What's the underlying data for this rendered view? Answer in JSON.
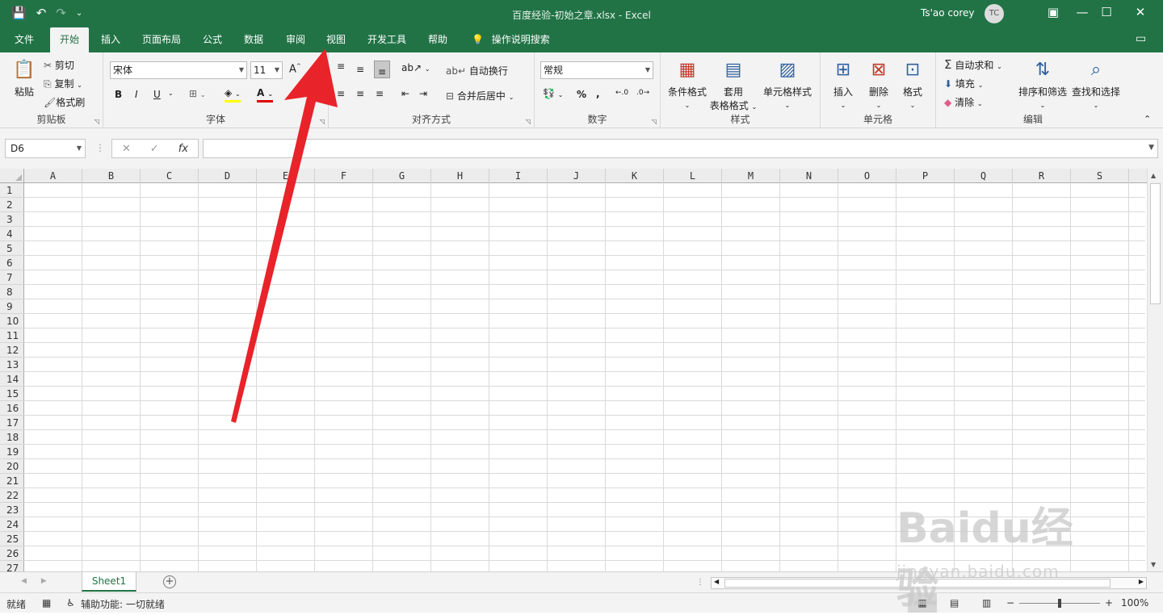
{
  "window": {
    "title": "百度经验-初始之章.xlsx  -  Excel",
    "user_name": "Ts'ao corey",
    "user_initials": "TC"
  },
  "tabs": [
    "文件",
    "开始",
    "插入",
    "页面布局",
    "公式",
    "数据",
    "审阅",
    "视图",
    "开发工具",
    "帮助"
  ],
  "active_tab": "开始",
  "tell_me": "操作说明搜索",
  "ribbon": {
    "clipboard": {
      "label": "剪贴板",
      "paste": "粘贴",
      "cut": "剪切",
      "copy": "复制",
      "format_painter": "格式刷"
    },
    "font": {
      "label": "字体",
      "font_name": "宋体",
      "font_size": "11",
      "bold": "B",
      "italic": "I",
      "underline": "U"
    },
    "alignment": {
      "label": "对齐方式",
      "wrap_text": "自动换行",
      "merge_center": "合并后居中"
    },
    "number": {
      "label": "数字",
      "format": "常规",
      "percent": "%"
    },
    "styles": {
      "label": "样式",
      "conditional": "条件格式",
      "table_format_1": "套用",
      "table_format_2": "表格格式",
      "cell_styles": "单元格样式"
    },
    "cells": {
      "label": "单元格",
      "insert": "插入",
      "delete": "删除",
      "format": "格式"
    },
    "editing": {
      "label": "编辑",
      "autosum": "自动求和",
      "fill": "填充",
      "clear": "清除",
      "sort_filter": "排序和筛选",
      "find_select": "查找和选择"
    }
  },
  "formula_bar": {
    "name_box": "D6",
    "fx": "fx",
    "formula": ""
  },
  "columns": [
    "A",
    "B",
    "C",
    "D",
    "E",
    "F",
    "G",
    "H",
    "I",
    "J",
    "K",
    "L",
    "M",
    "N",
    "O",
    "P",
    "Q",
    "R",
    "S"
  ],
  "rows": [
    "1",
    "2",
    "3",
    "4",
    "5",
    "6",
    "7",
    "8",
    "9",
    "10",
    "11",
    "12",
    "13",
    "14",
    "15",
    "16",
    "17",
    "18",
    "19",
    "20",
    "21",
    "22",
    "23",
    "24",
    "25",
    "26",
    "27"
  ],
  "sheets": [
    "Sheet1"
  ],
  "status": {
    "ready": "就绪",
    "accessibility": "辅助功能: 一切就绪",
    "zoom": "100%"
  },
  "watermark": {
    "brand": "Baidu经验",
    "url": "jingyan.baidu.com"
  },
  "colors": {
    "excel_green": "#217346",
    "arrow": "#e8232a"
  }
}
